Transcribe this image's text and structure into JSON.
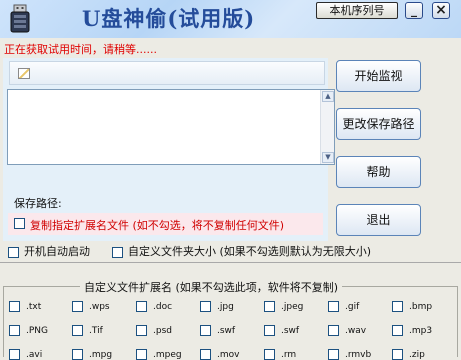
{
  "window": {
    "title": "U盘神偷(试用版)",
    "serial_button": "本机序列号",
    "minimize_glyph": "_",
    "close_glyph": "×"
  },
  "status": {
    "text": "正在获取试用时间，请稍等......",
    "color": "#e00000"
  },
  "buttons": {
    "start": "开始监视",
    "change_path": "更改保存路径",
    "help": "帮助",
    "exit": "退出"
  },
  "save": {
    "label": "保存路径:",
    "copy_option": "复制指定扩展名文件 (如不勾选，将不复制任何文件)"
  },
  "options": {
    "autostart": "开机自动启动",
    "custom_size": "自定义文件夹大小 (如果不勾选则默认为无限大小)"
  },
  "extensions": {
    "title": "自定义文件扩展名 (如果不勾选此项，软件将不复制)",
    "rows": [
      [
        ".txt",
        ".wps",
        ".doc",
        ".jpg",
        ".jpeg",
        ".gif",
        ".bmp"
      ],
      [
        ".PNG",
        ".Tif",
        ".psd",
        ".swf",
        ".swf",
        ".wav",
        ".mp3"
      ],
      [
        ".avi",
        ".mpg",
        ".mpeg",
        ".mov",
        ".rm",
        ".rmvb",
        ".zip"
      ]
    ]
  },
  "icons": {
    "app": "usb-drive-icon",
    "header": "edit-document-icon"
  },
  "colors": {
    "title_text": "#244c9a",
    "status_text": "#e00000",
    "copy_option_text": "#d00000",
    "panel_bg": "#e4f0f9"
  }
}
